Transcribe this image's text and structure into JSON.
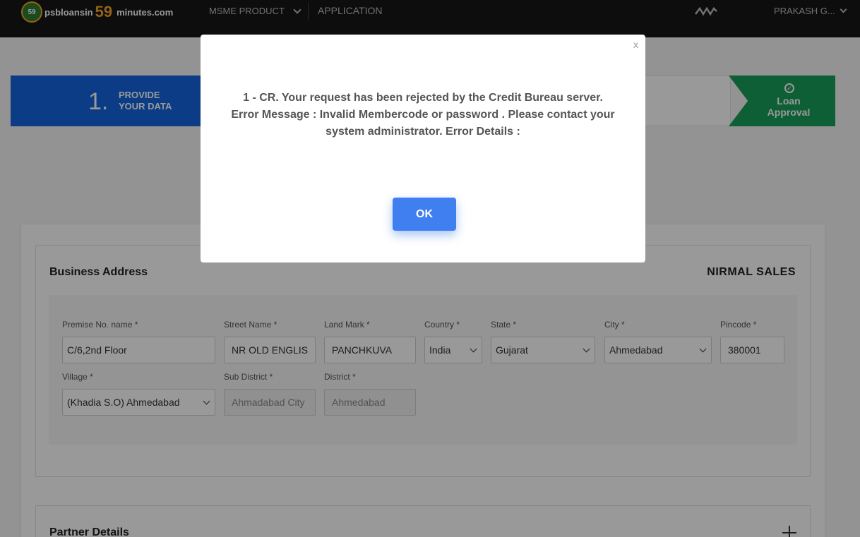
{
  "nav": {
    "logo_badge": "59",
    "logo_text_1": "psbloansin",
    "logo_num": "59",
    "logo_text_2": "minutes.com",
    "product_label": "MSME PRODUCT",
    "application_label": "APPLICATION",
    "user_label": "PRAKASH G..."
  },
  "steps": {
    "step1_number": "1.",
    "step1_label": "PROVIDE YOUR DATA",
    "final_label": "Loan Approval"
  },
  "business": {
    "title": "Business Address",
    "company": "NIRMAL SALES",
    "fields": {
      "premise": {
        "label": "Premise No. name *",
        "value": "C/6,2nd Floor"
      },
      "street": {
        "label": "Street Name *",
        "value": "NR OLD ENGLIS"
      },
      "landmark": {
        "label": "Land Mark *",
        "value": "PANCHKUVA"
      },
      "country": {
        "label": "Country *",
        "value": "India"
      },
      "state": {
        "label": "State *",
        "value": "Gujarat"
      },
      "city": {
        "label": "City *",
        "value": "Ahmedabad"
      },
      "pincode": {
        "label": "Pincode *",
        "value": "380001"
      },
      "village": {
        "label": "Village *",
        "value": "(Khadia S.O) Ahmedabad"
      },
      "subdistrict": {
        "label": "Sub District *",
        "value": "Ahmadabad City"
      },
      "district": {
        "label": "District *",
        "value": "Ahmedabad"
      }
    }
  },
  "partner": {
    "title": "Partner Details"
  },
  "modal": {
    "close": "x",
    "message": "1 - CR. Your request has been rejected by the Credit Bureau server. Error Message : Invalid Membercode or password . Please contact your system administrator. Error Details :",
    "ok_label": "OK"
  },
  "colors": {
    "primary": "#1565e0",
    "success": "#1a9f5a",
    "button": "#3f7ff0",
    "nav_bg": "#161616"
  }
}
